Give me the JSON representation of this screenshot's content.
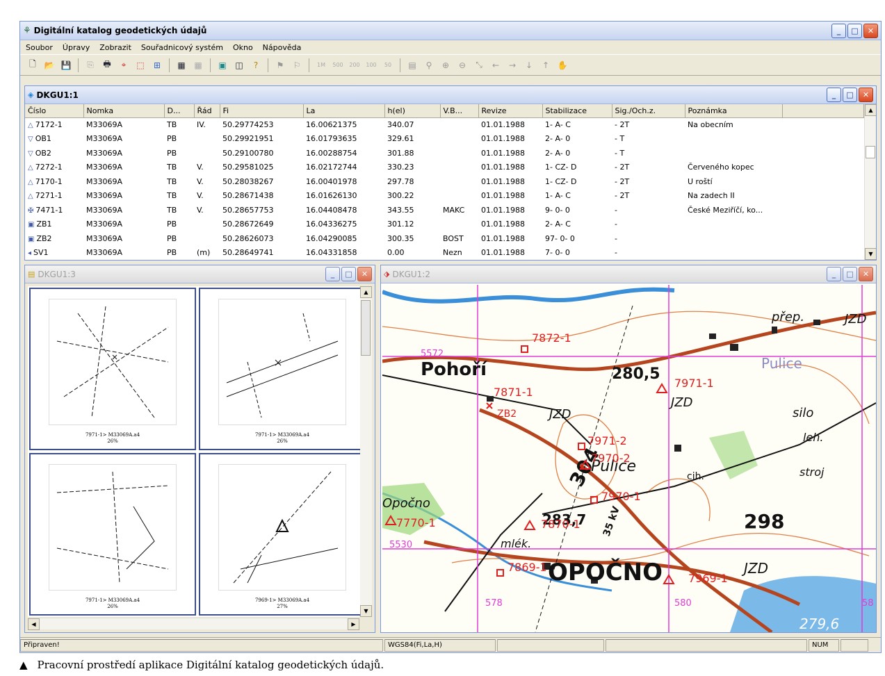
{
  "app": {
    "title": "Digitální katalog geodetických údajů"
  },
  "menu": [
    "Soubor",
    "Úpravy",
    "Zobrazit",
    "Souřadnicový systém",
    "Okno",
    "Nápověda"
  ],
  "toolbar": {
    "scales": [
      "1M",
      "500",
      "200",
      "100",
      "50"
    ]
  },
  "table_window": {
    "title": "DKGU1:1",
    "columns": [
      "Číslo",
      "Nomka",
      "D...",
      "Řád",
      "Fi",
      "La",
      "h(el)",
      "V.B...",
      "Revize",
      "Stabilizace",
      "Sig./Och.z.",
      "Poznámka"
    ],
    "rows": [
      {
        "sym": "△",
        "c": [
          "7172-1",
          "M33069A",
          "TB",
          "IV.",
          "50.29774253",
          "16.00621375",
          "340.07",
          "",
          "01.01.1988",
          "1- A- C",
          "- 2T",
          "Na obecním"
        ]
      },
      {
        "sym": "▽",
        "c": [
          "OB1",
          "M33069A",
          "PB",
          "",
          "50.29921951",
          "16.01793635",
          "329.61",
          "",
          "01.01.1988",
          "2- A- 0",
          "- T",
          ""
        ]
      },
      {
        "sym": "▽",
        "c": [
          "OB2",
          "M33069A",
          "PB",
          "",
          "50.29100780",
          "16.00288754",
          "301.88",
          "",
          "01.01.1988",
          "2- A- 0",
          "- T",
          ""
        ]
      },
      {
        "sym": "△",
        "c": [
          "7272-1",
          "M33069A",
          "TB",
          "V.",
          "50.29581025",
          "16.02172744",
          "330.23",
          "",
          "01.01.1988",
          "1- CZ- D",
          "- 2T",
          "Červeného kopec"
        ]
      },
      {
        "sym": "△",
        "c": [
          "7170-1",
          "M33069A",
          "TB",
          "V.",
          "50.28038267",
          "16.00401978",
          "297.78",
          "",
          "01.01.1988",
          "1- CZ- D",
          "- 2T",
          "U roští"
        ]
      },
      {
        "sym": "△",
        "c": [
          "7271-1",
          "M33069A",
          "TB",
          "V.",
          "50.28671438",
          "16.01626130",
          "300.22",
          "",
          "01.01.1988",
          "1- A- C",
          "- 2T",
          "Na zadech II"
        ]
      },
      {
        "sym": "✠",
        "c": [
          "7471-1",
          "M33069A",
          "TB",
          "V.",
          "50.28657753",
          "16.04408478",
          "343.55",
          "MAKC",
          "01.01.1988",
          "9- 0- 0",
          "-",
          "České Meziříčí, ko..."
        ]
      },
      {
        "sym": "▣",
        "c": [
          "ZB1",
          "M33069A",
          "PB",
          "",
          "50.28672649",
          "16.04336275",
          "301.12",
          "",
          "01.01.1988",
          "2- A- C",
          "-",
          ""
        ]
      },
      {
        "sym": "▣",
        "c": [
          "ZB2",
          "M33069A",
          "PB",
          "",
          "50.28626073",
          "16.04290085",
          "300.35",
          "BOST",
          "01.01.1988",
          "97- 0- 0",
          "-",
          ""
        ]
      },
      {
        "sym": "◂",
        "c": [
          "SV1",
          "M33069A",
          "PB",
          "(m)",
          "50.28649741",
          "16.04331858",
          "0.00",
          "Nezn",
          "01.01.1988",
          "7- 0- 0",
          "-",
          ""
        ]
      }
    ]
  },
  "thumb_window": {
    "title": "DKGU1:3",
    "thumbs": [
      {
        "cap1": "7971-1> M33069A.a4",
        "cap2": "26%"
      },
      {
        "cap1": "7971-1> M33069A.a4",
        "cap2": "26%"
      },
      {
        "cap1": "7971-1> M33069A.a4",
        "cap2": "26%"
      },
      {
        "cap1": "7969-1> M33069A.a4",
        "cap2": "27%"
      }
    ]
  },
  "map_window": {
    "title": "DKGU1:2",
    "labels": {
      "pohori": "Pohoří",
      "opocno": "OPOČNO",
      "pulice": "Pulice",
      "pulice2": "Pulice",
      "prep": "přep.",
      "jzd1": "JZD",
      "jzd2": "JZD",
      "jzd3": "JZD",
      "jzd4": "JZD",
      "silo": "silo",
      "leh": "leh.",
      "stroj": "stroj",
      "cih": "cih.",
      "mlek": "mlék.",
      "opocno_small": "Opočno",
      "n2805": "280,5",
      "n304": "304",
      "n298": "298",
      "n2837": "283,7",
      "n2796": "279,6",
      "kv": "35 kV",
      "p7872": "7872-1",
      "p5572": "5572",
      "p7871": "7871-1",
      "p7971": "7971-1",
      "pzb": "ZB2",
      "p79712": "7971-2",
      "p79702": "7970-2",
      "p79701": "7970-1",
      "p7770": "7770-1",
      "p7870": "7870-1",
      "p7869": "7869-1",
      "p7969": "7969-1",
      "p5530": "5530",
      "p578": "578",
      "p580": "580",
      "p58": "58"
    }
  },
  "status": {
    "ready": "Připraven!",
    "coord": "WGS84(Fi,La,H)",
    "num": "NUM"
  },
  "caption": {
    "marker": "▲",
    "text": "Pracovní prostředí aplikace Digitální katalog geodetických údajů."
  }
}
